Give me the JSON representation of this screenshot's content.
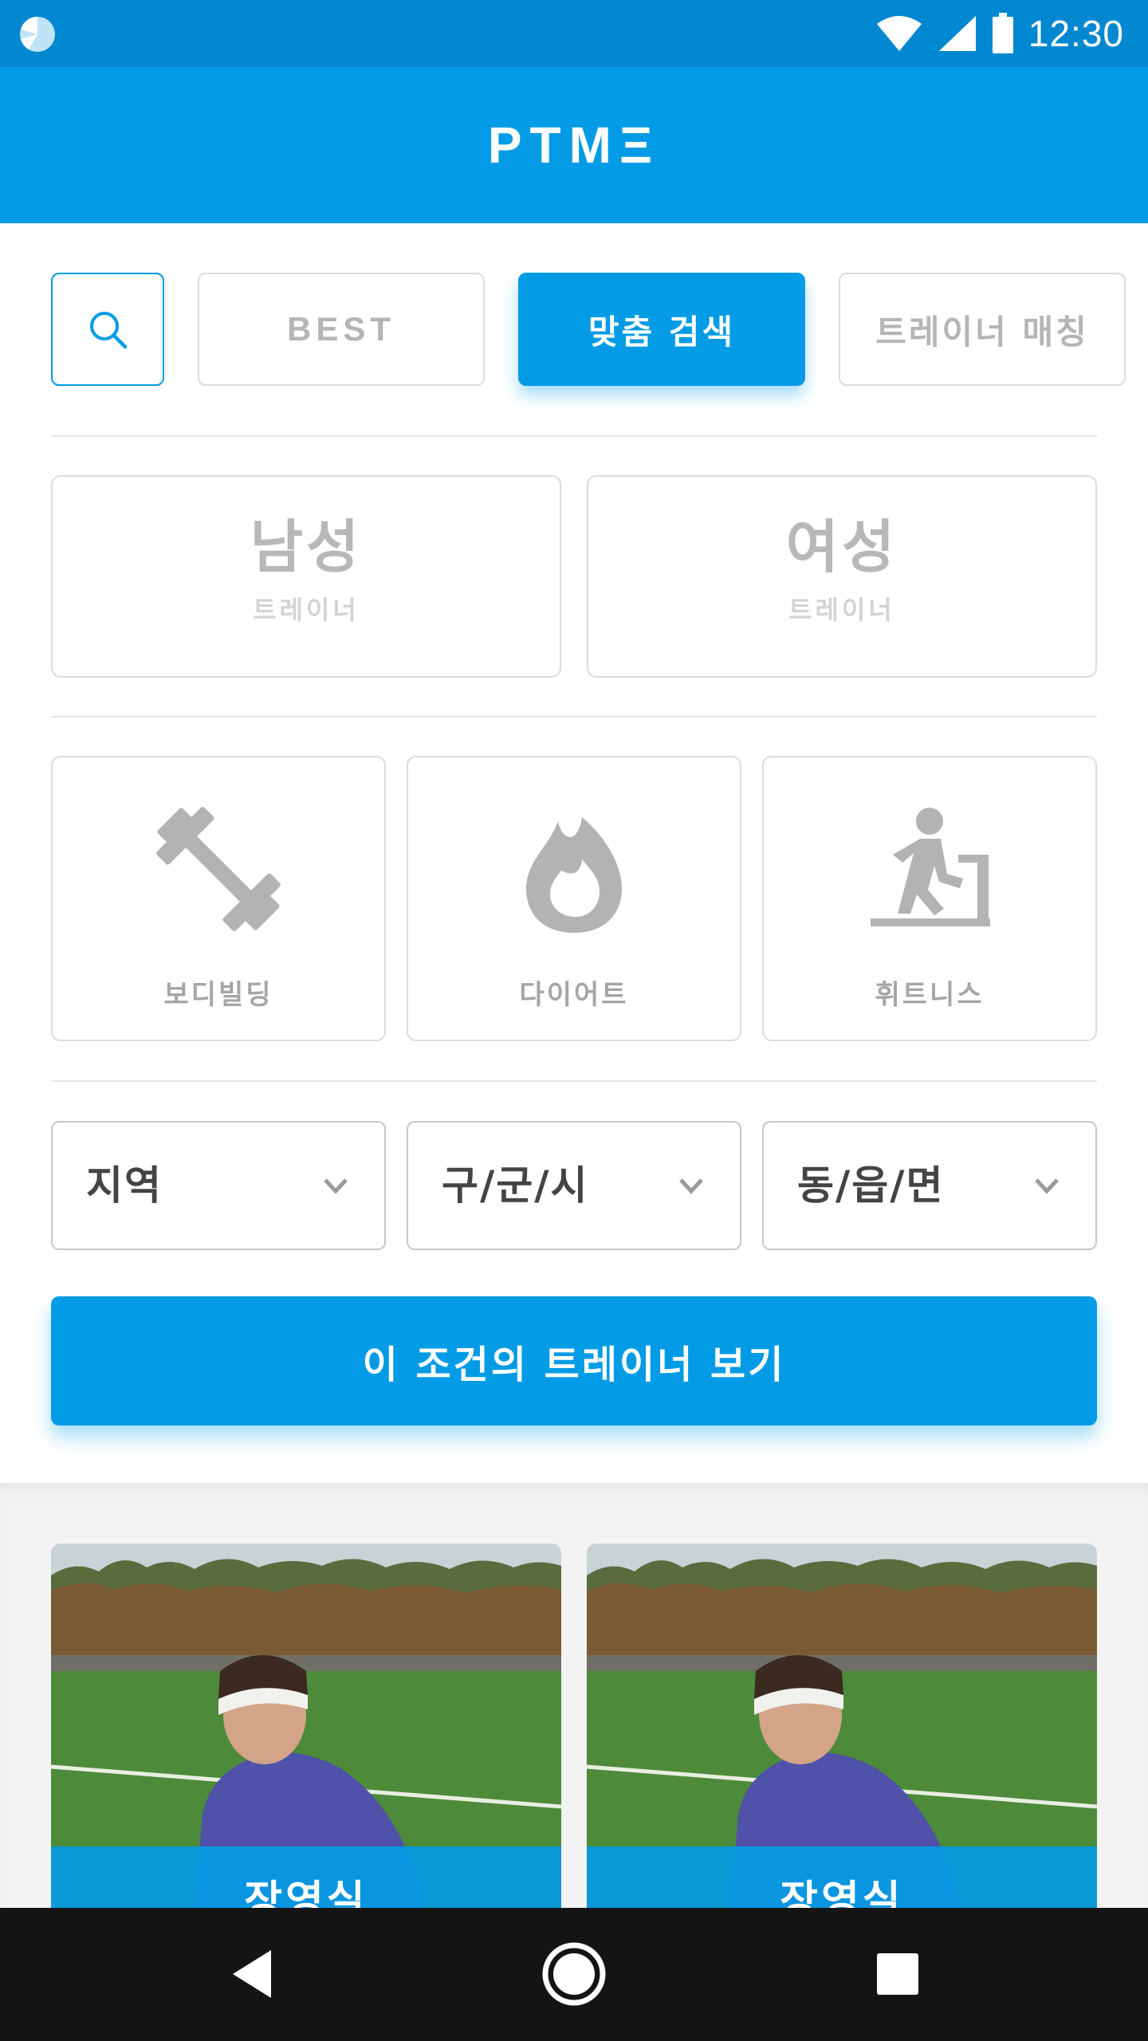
{
  "status_bar": {
    "time": "12:30",
    "icons": [
      "app-notification-icon",
      "wifi-icon",
      "cellular-signal-icon",
      "battery-icon"
    ]
  },
  "app_bar": {
    "logo": "PTMΞ"
  },
  "tabs": {
    "search_icon": "search-icon",
    "best": "BEST",
    "custom_search": "맞춤 검색",
    "trainer_matching": "트레이너 매칭",
    "active": "custom_search"
  },
  "gender": {
    "male": {
      "label": "남성",
      "sub": "트레이너"
    },
    "female": {
      "label": "여성",
      "sub": "트레이너"
    }
  },
  "categories": [
    {
      "label": "보디빌딩",
      "icon": "dumbbell-icon"
    },
    {
      "label": "다이어트",
      "icon": "flame-icon"
    },
    {
      "label": "휘트니스",
      "icon": "treadmill-icon"
    }
  ],
  "filters": {
    "region": "지역",
    "district": "구/군/시",
    "town": "동/읍/면"
  },
  "cta": {
    "label": "이 조건의 트레이너 보기"
  },
  "trainer_cards": [
    {
      "name": "장영실"
    },
    {
      "name": "장영실"
    }
  ],
  "colors": {
    "primary": "#039be5",
    "status_bar": "#0288d1",
    "nav_bar": "#141414"
  }
}
